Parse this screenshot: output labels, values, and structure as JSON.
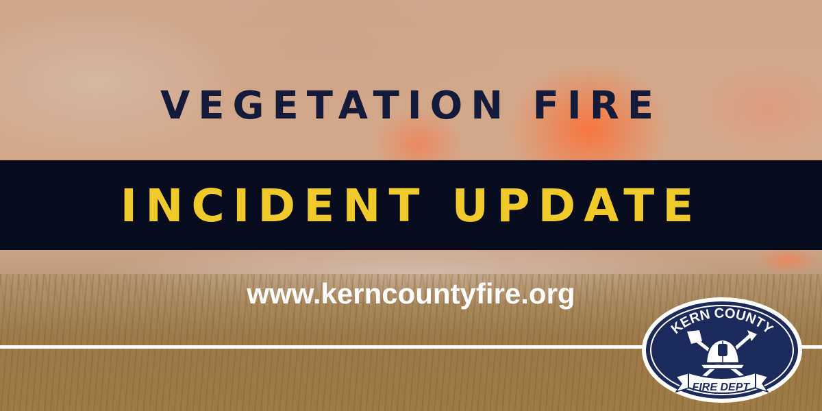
{
  "banner": {
    "headline": "VEGETATION FIRE",
    "band_text": "INCIDENT UPDATE",
    "website": "www.kerncountyfire.org"
  },
  "logo": {
    "top_text": "KERN COUNTY",
    "ribbon_text": "FIRE DEPT.",
    "icon": "fire-helmet-axe-emblem"
  },
  "colors": {
    "headline": "#141a3a",
    "band_background": "#070b1d",
    "band_text": "#f0c92a",
    "website": "#ffffff",
    "logo_navy": "#1b2a5a"
  }
}
